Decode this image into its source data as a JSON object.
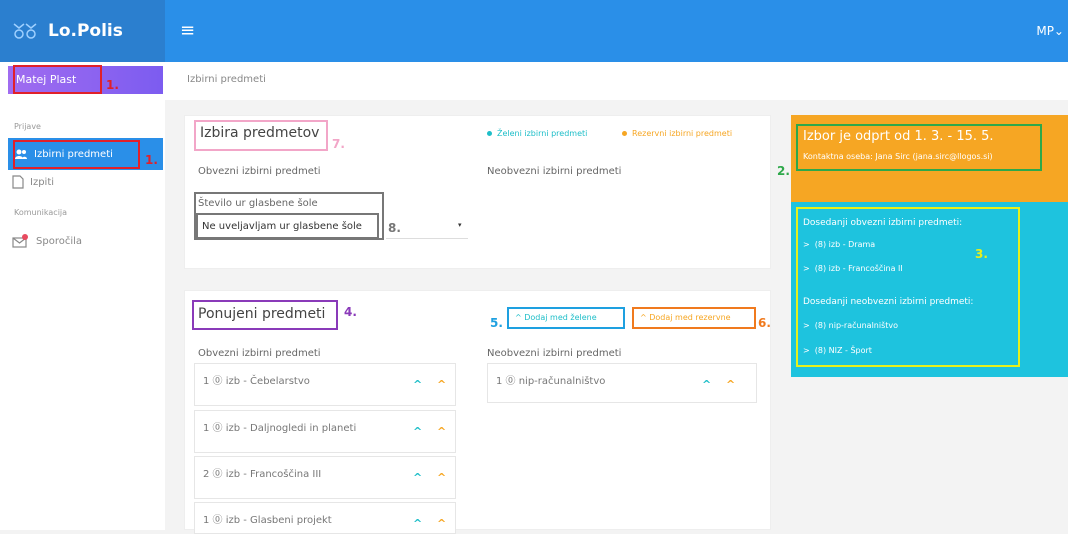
{
  "header": {
    "app_name": "Lo.Polis",
    "menu_glyph": "≡",
    "user_initials": "MP⌄"
  },
  "sidebar": {
    "user_name": "Matej Plast",
    "section_prijave": "Prijave",
    "item_izbirni": "Izbirni predmeti",
    "item_izpiti": "Izpiti",
    "section_komunikacija": "Komunikacija",
    "item_sporocila": "Sporočila"
  },
  "breadcrumb": "Izbirni predmeti",
  "selection_card": {
    "title": "Izbira predmetov",
    "legend_green": "Želeni izbirni predmeti",
    "legend_orange": "Rezervni izbirni predmeti",
    "mandatory_label": "Obvezni izbirni predmeti",
    "optional_label": "Neobvezni izbirni predmeti",
    "music_label": "Število ur glasbene šole",
    "music_select": "Ne uveljavljam ur glasbene šole",
    "select_arrow": "▾"
  },
  "offer_card": {
    "title": "Ponujeni predmeti",
    "btn_green": "Dodaj med želene",
    "btn_orange": "Dodaj med rezervne",
    "mandatory_label": "Obvezni izbirni predmeti",
    "optional_label": "Neobvezni izbirni predmeti",
    "chevron": "^",
    "mandatory_courses": [
      "1 ⓪ izb - Čebelarstvo",
      "1 ⓪ izb - Daljnogledi in planeti",
      "2 ⓪ izb - Francoščina III",
      "1 ⓪ izb - Glasbeni projekt"
    ],
    "optional_courses": [
      "1 ⓪ nip-računalništvo"
    ]
  },
  "info_orange": {
    "title": "Izbor je odprt od 1. 3. - 15. 5.",
    "contact": "Kontaktna oseba: Jana Sirc (jana.sirc@llogos.si)"
  },
  "info_cyan": {
    "prev_mandatory_title": "Dosedanji obvezni izbirni predmeti:",
    "prev_mandatory": [
      "(8) izb - Drama",
      "(8) izb - Francoščina II"
    ],
    "prev_optional_title": "Dosedanji neobvezni izbirni predmeti:",
    "prev_optional": [
      "(8) nip-računalništvo",
      "(8) NIZ - Šport"
    ]
  },
  "annotations": {
    "n1a": "1.",
    "n1b": "1.",
    "n2": "2.",
    "n3": "3.",
    "n4": "4.",
    "n5": "5.",
    "n6": "6.",
    "n7": "7.",
    "n8": "8."
  },
  "colors": {
    "brand_blue": "#2a8fe8",
    "green_teal": "#1ebec8",
    "orange": "#f6a623",
    "red_box": "#e0202a",
    "pink_box": "#f2a6c8",
    "gray_box": "#777777",
    "purple_box": "#8a3ab9",
    "cyan_box": "#1ea0e0",
    "orange_box": "#f07a1e",
    "green_box": "#2ea84a",
    "yellow_box": "#e8f01a"
  }
}
